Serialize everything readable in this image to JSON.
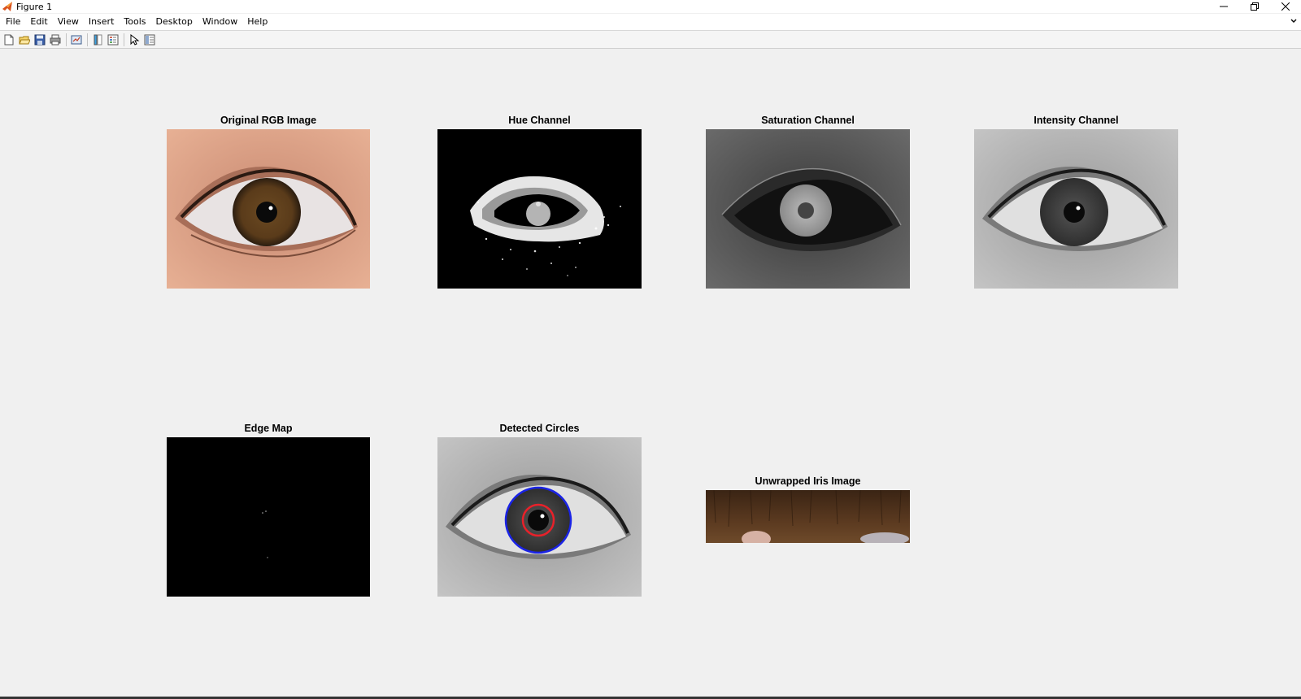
{
  "window": {
    "title": "Figure 1",
    "controls": [
      "minimize-icon",
      "restore-icon",
      "close-icon"
    ]
  },
  "menu": {
    "items": [
      {
        "label": "File"
      },
      {
        "label": "Edit"
      },
      {
        "label": "View"
      },
      {
        "label": "Insert"
      },
      {
        "label": "Tools"
      },
      {
        "label": "Desktop"
      },
      {
        "label": "Window"
      },
      {
        "label": "Help"
      }
    ]
  },
  "toolbar": {
    "icons": [
      "new-figure-icon",
      "open-file-icon",
      "save-icon",
      "print-icon",
      "link-plot-icon",
      "colorbar-icon",
      "legend-icon",
      "edit-plot-icon",
      "property-inspector-icon"
    ]
  },
  "axes": {
    "original": {
      "title": "Original RGB Image"
    },
    "hue": {
      "title": "Hue Channel"
    },
    "saturation": {
      "title": "Saturation Channel"
    },
    "intensity": {
      "title": "Intensity Channel"
    },
    "edge": {
      "title": "Edge Map"
    },
    "circles": {
      "title": "Detected Circles"
    },
    "unwrapped": {
      "title": "Unwrapped Iris Image"
    }
  },
  "colors": {
    "pupil_circle": "#e8212a",
    "iris_circle": "#1a23e6",
    "window_bg": "#f0f0f0"
  }
}
